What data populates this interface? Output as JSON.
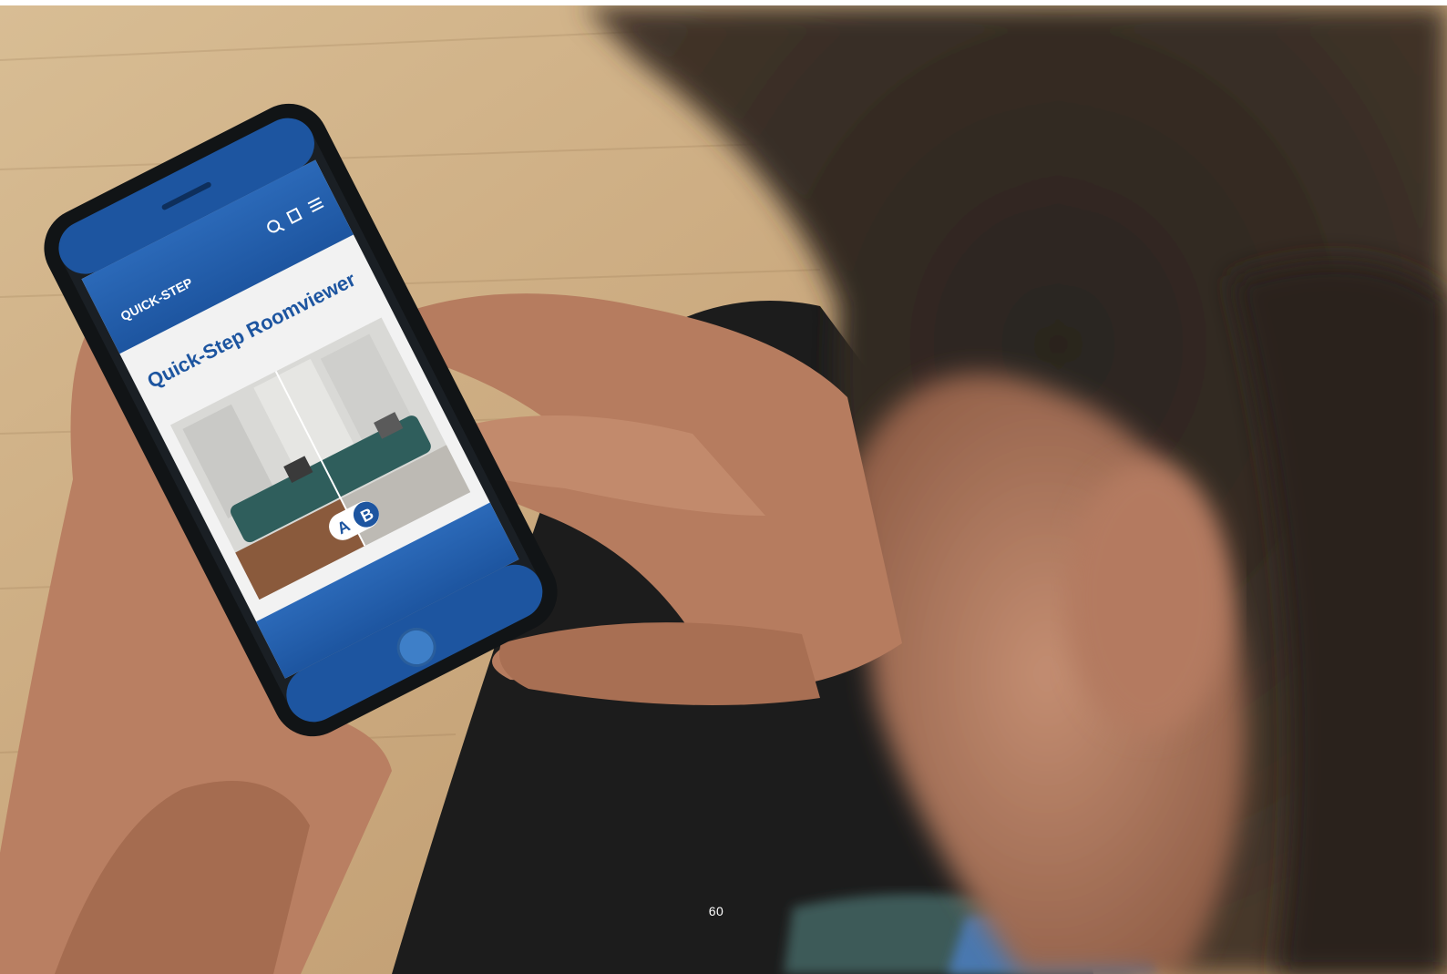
{
  "photo": {
    "description_alt": "Person holding a smartphone showing the Quick-Step Roomviewer app",
    "phone_screen": {
      "brand_logo": "QUICK-STEP",
      "title": "Quick-Step Roomviewer",
      "compare_left": "A",
      "compare_right": "B",
      "icons": [
        "search-icon",
        "store-icon",
        "menu-icon"
      ]
    }
  },
  "colors": {
    "brand_blue": "#1f5fb0",
    "wood": "#c9a77c"
  },
  "page": {
    "number": "60"
  }
}
